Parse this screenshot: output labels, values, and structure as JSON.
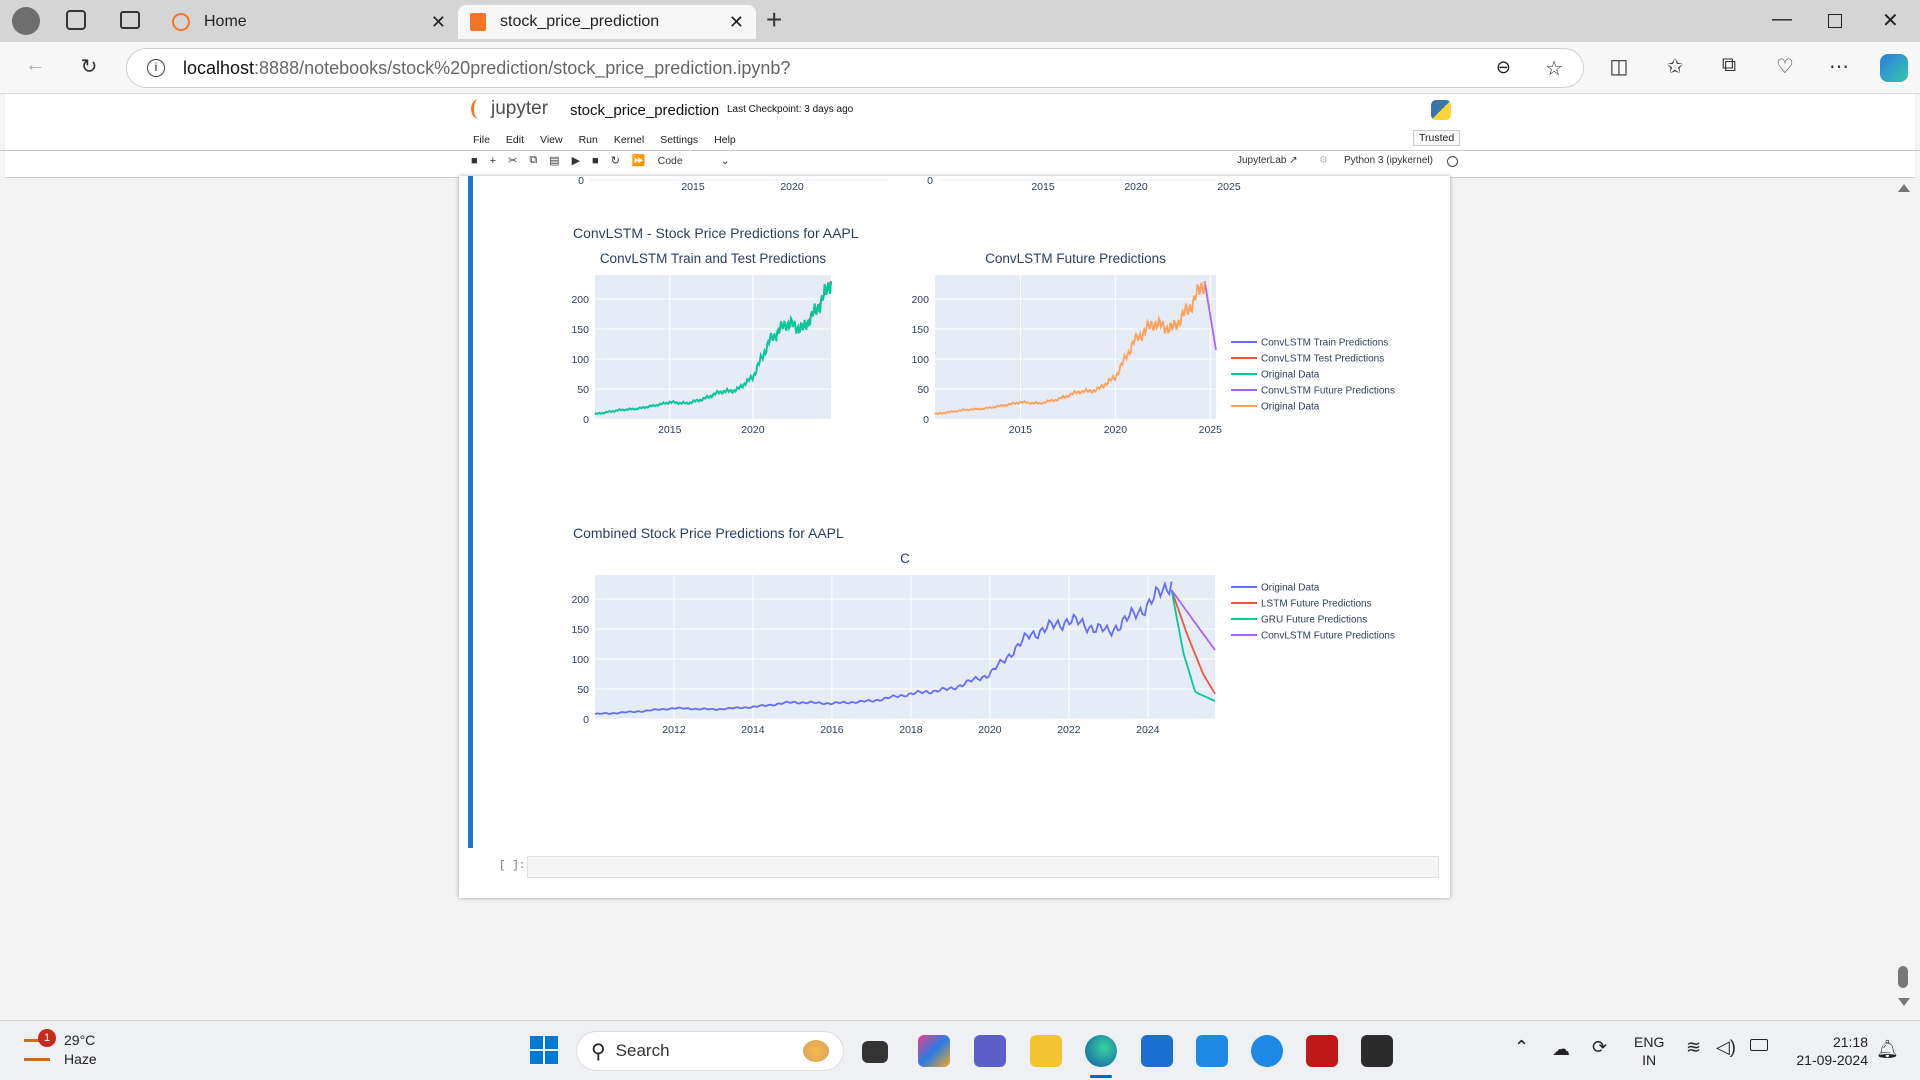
{
  "browser": {
    "tabs": [
      {
        "label": "Home"
      },
      {
        "label": "stock_price_prediction"
      }
    ],
    "url_host": "localhost",
    "url_rest": ":8888/notebooks/stock%20prediction/stock_price_prediction.ipynb?"
  },
  "jupyter": {
    "logo_text": "jupyter",
    "notebook_name": "stock_price_prediction",
    "checkpoint": "Last Checkpoint: 3 days ago",
    "menu": [
      "File",
      "Edit",
      "View",
      "Run",
      "Kernel",
      "Settings",
      "Help"
    ],
    "trusted": "Trusted",
    "cell_type": "Code",
    "jupyterlab_link": "JupyterLab",
    "kernel": "Python 3 (ipykernel)",
    "prompt": "[ ]:"
  },
  "outputs": {
    "convlstm_heading": "ConvLSTM - Stock Price Predictions for AAPL",
    "combined_heading": "Combined Stock Price Predictions for AAPL"
  },
  "chart_data": [
    {
      "type": "line",
      "title": "",
      "x_ticks": [
        "2015",
        "2020"
      ],
      "y_ticks": [
        "0"
      ],
      "note": "partially visible previous chart (left)"
    },
    {
      "type": "line",
      "title": "",
      "x_ticks": [
        "2015",
        "2020",
        "2025"
      ],
      "y_ticks": [
        "0"
      ],
      "note": "partially visible previous chart (right)"
    },
    {
      "type": "line",
      "title": "ConvLSTM Train and Test Predictions",
      "x_ticks": [
        "2015",
        "2020"
      ],
      "y_ticks": [
        "0",
        "50",
        "100",
        "150",
        "200"
      ],
      "ylim": [
        0,
        240
      ],
      "xlim": [
        2010.5,
        2024.7
      ],
      "series": [
        {
          "name": "ConvLSTM Train Predictions",
          "color": "#636efa",
          "x": [
            2010.5,
            2012,
            2013,
            2014,
            2015,
            2016,
            2017,
            2018,
            2019,
            2020,
            2021,
            2022,
            2023,
            2024,
            2024.7
          ],
          "y": [
            8,
            15,
            17,
            22,
            28,
            26,
            33,
            45,
            48,
            70,
            130,
            160,
            150,
            190,
            230
          ]
        },
        {
          "name": "ConvLSTM Test Predictions",
          "color": "#ef553b",
          "x": [
            2023,
            2024,
            2024.7
          ],
          "y": [
            150,
            190,
            230
          ]
        },
        {
          "name": "Original Data",
          "color": "#00cc96",
          "x": [
            2010.5,
            2012,
            2013,
            2014,
            2015,
            2016,
            2017,
            2018,
            2019,
            2020,
            2021,
            2022,
            2023,
            2024,
            2024.7
          ],
          "y": [
            8,
            15,
            17,
            22,
            28,
            26,
            33,
            45,
            48,
            70,
            130,
            160,
            150,
            190,
            230
          ]
        }
      ],
      "legend": "right"
    },
    {
      "type": "line",
      "title": "ConvLSTM Future Predictions",
      "x_ticks": [
        "2015",
        "2020",
        "2025"
      ],
      "y_ticks": [
        "0",
        "50",
        "100",
        "150",
        "200"
      ],
      "ylim": [
        0,
        240
      ],
      "xlim": [
        2010.5,
        2025.3
      ],
      "series": [
        {
          "name": "ConvLSTM Future Predictions",
          "color": "#ab63fa",
          "x": [
            2024.7,
            2025.3
          ],
          "y": [
            230,
            115
          ]
        },
        {
          "name": "Original Data",
          "color": "#ffa15a",
          "x": [
            2010.5,
            2012,
            2013,
            2014,
            2015,
            2016,
            2017,
            2018,
            2019,
            2020,
            2021,
            2022,
            2023,
            2024,
            2024.7
          ],
          "y": [
            8,
            15,
            17,
            22,
            28,
            26,
            33,
            45,
            48,
            70,
            130,
            160,
            150,
            190,
            230
          ]
        }
      ],
      "legend": "right"
    },
    {
      "type": "line",
      "title": "C",
      "x_ticks": [
        "2012",
        "2014",
        "2016",
        "2018",
        "2020",
        "2022",
        "2024"
      ],
      "y_ticks": [
        "0",
        "50",
        "100",
        "150",
        "200"
      ],
      "ylim": [
        0,
        240
      ],
      "xlim": [
        2010.0,
        2025.7
      ],
      "series": [
        {
          "name": "Original Data",
          "color": "#636efa",
          "x": [
            2010,
            2011,
            2012,
            2013,
            2014,
            2015,
            2016,
            2017,
            2018,
            2019,
            2020,
            2021,
            2022,
            2023,
            2024,
            2024.6
          ],
          "y": [
            8,
            12,
            18,
            16,
            20,
            28,
            26,
            30,
            42,
            50,
            75,
            140,
            165,
            145,
            190,
            230
          ]
        },
        {
          "name": "LSTM Future Predictions",
          "color": "#ef553b",
          "x": [
            2024.6,
            2025,
            2025.4,
            2025.7
          ],
          "y": [
            215,
            140,
            75,
            42
          ]
        },
        {
          "name": "GRU Future Predictions",
          "color": "#00cc96",
          "x": [
            2024.6,
            2024.9,
            2025.2,
            2025.7
          ],
          "y": [
            215,
            110,
            45,
            30
          ]
        },
        {
          "name": "ConvLSTM Future Predictions",
          "color": "#ab63fa",
          "x": [
            2024.6,
            2025.2,
            2025.7
          ],
          "y": [
            215,
            160,
            115
          ]
        }
      ],
      "legend": "right"
    }
  ],
  "taskbar": {
    "weather_temp": "29°C",
    "weather_desc": "Haze",
    "weather_badge": "1",
    "search_label": "Search",
    "lang": "ENG",
    "region": "IN",
    "time": "21:18",
    "date": "21-09-2024"
  }
}
